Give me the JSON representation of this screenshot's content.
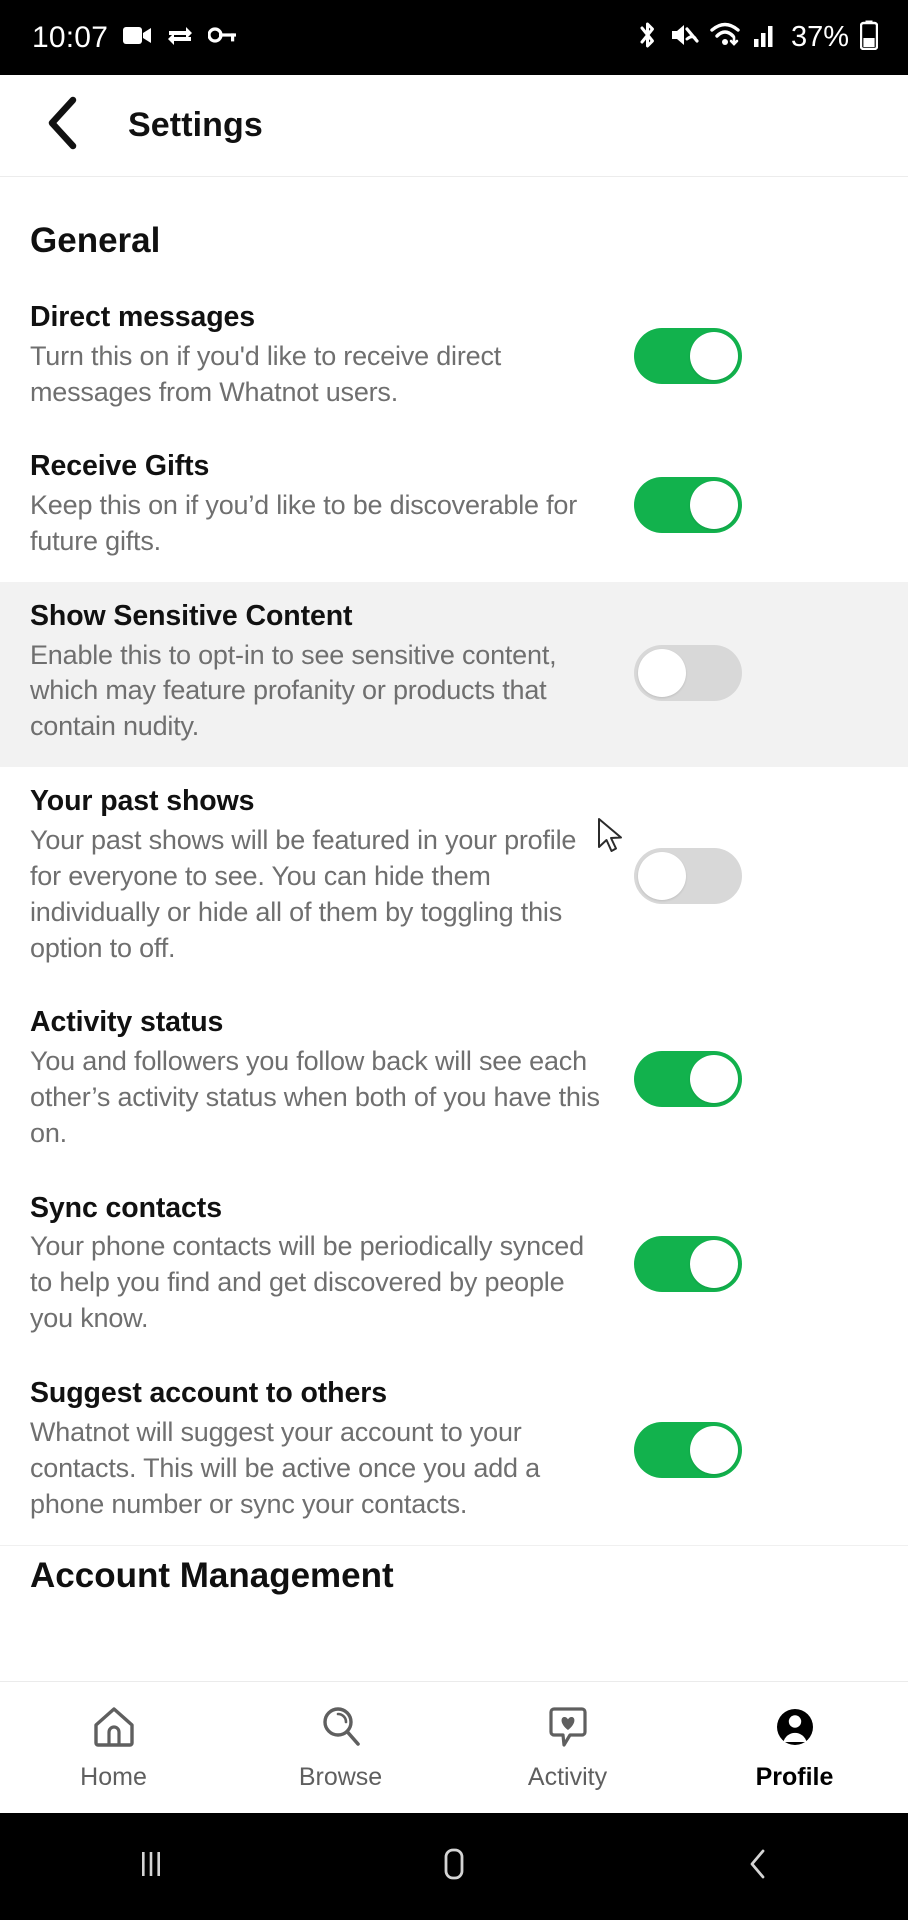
{
  "statusbar": {
    "time": "10:07",
    "battery_percent": "37%",
    "left_icons": [
      "video-camera-icon",
      "sync-transfer-icon",
      "key-icon"
    ],
    "right_icons": [
      "bluetooth-icon",
      "mute-icon",
      "wifi-icon",
      "cellular-signal-icon",
      "battery-icon"
    ]
  },
  "header": {
    "back_icon": "chevron-left-icon",
    "title": "Settings"
  },
  "sections": [
    {
      "title": "General"
    },
    {
      "title": "Account Management"
    }
  ],
  "colors": {
    "toggle_on": "#12b24d",
    "toggle_off": "#d8d8d8",
    "highlight_row": "#f2f2f2",
    "title_text": "#111111",
    "desc_text": "#6f6f6f"
  },
  "settings": [
    {
      "title": "Direct messages",
      "description": "Turn this on if you'd like to receive direct messages from Whatnot users.",
      "toggle": "on"
    },
    {
      "title": "Receive Gifts",
      "description": "Keep this on if you’d like to be discoverable for future gifts.",
      "toggle": "on"
    },
    {
      "title": "Show Sensitive Content",
      "description": "Enable this to opt-in to see sensitive content, which may feature profanity or products that contain nudity.",
      "toggle": "off",
      "highlighted": true
    },
    {
      "title": "Your past shows",
      "description": "Your past shows will be featured in your profile for everyone to see. You can hide them individually or hide all of them by toggling this option to off.",
      "toggle": "off"
    },
    {
      "title": "Activity status",
      "description": "You and followers you follow back will see each other’s activity status when both of you have this on.",
      "toggle": "on"
    },
    {
      "title": "Sync contacts",
      "description": "Your phone contacts will be periodically synced to help you find and get discovered by people you know.",
      "toggle": "on"
    },
    {
      "title": "Suggest account to others",
      "description": "Whatnot will suggest your account to your contacts. This will be active once you add a phone number or sync your contacts.",
      "toggle": "on"
    }
  ],
  "tabbar": [
    {
      "label": "Home",
      "icon": "home-icon",
      "active": false
    },
    {
      "label": "Browse",
      "icon": "search-icon",
      "active": false
    },
    {
      "label": "Activity",
      "icon": "activity-heart-bubble-icon",
      "active": false
    },
    {
      "label": "Profile",
      "icon": "profile-person-icon",
      "active": true
    }
  ],
  "sysnav": [
    {
      "icon": "recents-icon"
    },
    {
      "icon": "home-square-icon"
    },
    {
      "icon": "back-chevron-icon"
    }
  ]
}
